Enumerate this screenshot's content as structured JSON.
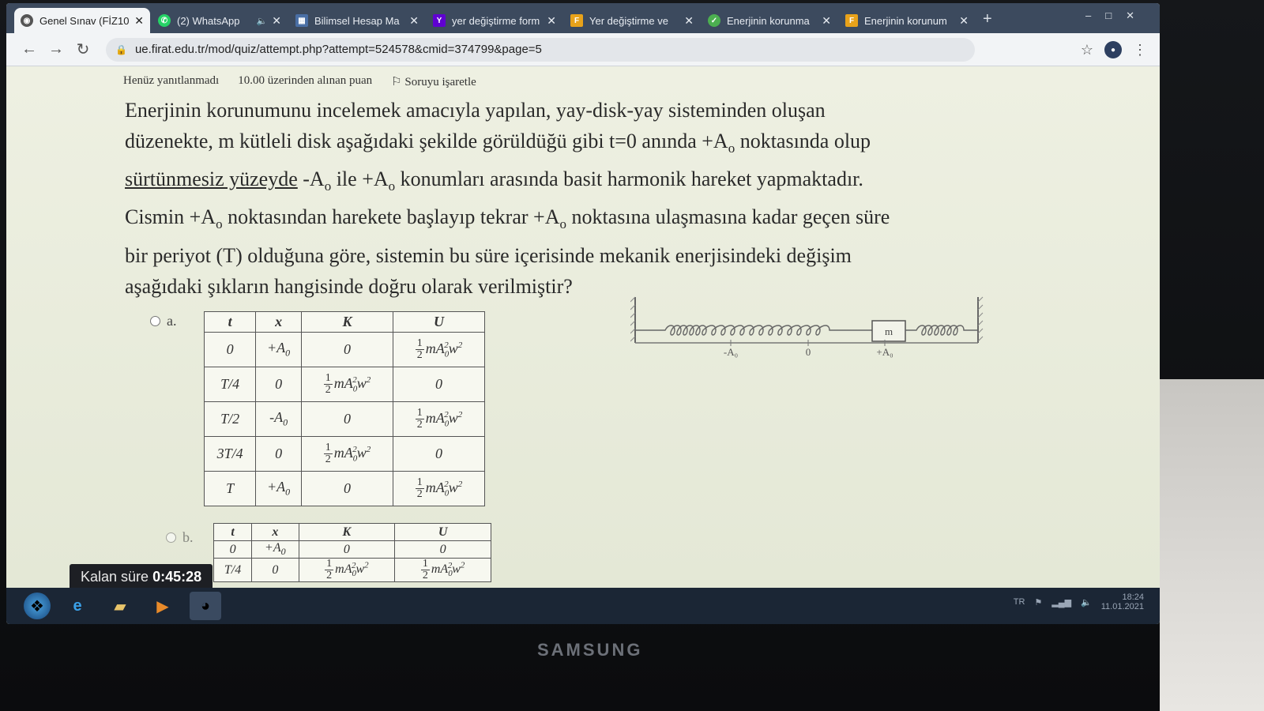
{
  "browser": {
    "tabs": [
      {
        "title": "Genel Sınav (FİZ10",
        "icon": "moodle-icon",
        "active": true,
        "color": "#555555"
      },
      {
        "title": "(2) WhatsApp",
        "icon": "whatsapp-icon",
        "active": false,
        "audio": true,
        "color": "#25d366"
      },
      {
        "title": "Bilimsel Hesap Ma",
        "icon": "calculator-icon",
        "active": false,
        "color": "#4a6fa5"
      },
      {
        "title": "yer değiştirme form",
        "icon": "yahoo-icon",
        "active": false,
        "color": "#5f01d1"
      },
      {
        "title": "Yer değiştirme ve",
        "icon": "document-icon",
        "active": false,
        "color": "#e8a21a"
      },
      {
        "title": "Enerjinin korunma",
        "icon": "shield-icon",
        "active": false,
        "color": "#4caf50"
      },
      {
        "title": "Enerjinin korunum",
        "icon": "document-icon",
        "active": false,
        "color": "#e8a21a"
      }
    ],
    "url": "ue.firat.edu.tr/mod/quiz/attempt.php?attempt=524578&cmid=374799&page=5"
  },
  "question_meta": {
    "status": "Henüz yanıtlanmadı",
    "points": "10.00 üzerinden alınan puan",
    "flag": "Soruyu işaretle"
  },
  "question": {
    "line1": "Enerjinin korunumunu incelemek amacıyla yapılan, yay-disk-yay sisteminden oluşan",
    "line2a": "düzenekte, m kütleli disk aşağıdaki şekilde görüldüğü gibi t=0 anında +A",
    "line2b": " noktasında olup",
    "line3a": "sürtünmesiz yüzeyde",
    "line3b": " -A",
    "line3c": " ile +A",
    "line3d": " konumları arasında basit harmonik hareket yapmaktadır.",
    "line4a": "Cismin +A",
    "line4b": " noktasından harekete başlayıp tekrar +A",
    "line4c": " noktasına ulaşmasına kadar geçen süre",
    "line5": "bir periyot (T) olduğuna göre, sistemin bu süre içerisinde mekanik enerjisindeki değişim",
    "line6": "aşağıdaki şıkların hangisinde doğru olarak verilmiştir?",
    "sub": "o"
  },
  "options": {
    "a_label": "a.",
    "b_label": "b.",
    "headers": [
      "t",
      "x",
      "K",
      "U"
    ],
    "frac_num": "1",
    "frac_den": "2",
    "energy_expr": "mA",
    "energy_sub": "0",
    "energy_sup": "2",
    "energy_w": "w",
    "a_rows": [
      {
        "t": "0",
        "x": "+A",
        "k": "0",
        "u": "E"
      },
      {
        "t": "T/4",
        "x": "0",
        "k": "E",
        "u": "0"
      },
      {
        "t": "T/2",
        "x": "-A",
        "k": "0",
        "u": "E"
      },
      {
        "t": "3T/4",
        "x": "0",
        "k": "E",
        "u": "0"
      },
      {
        "t": "T",
        "x": "+A",
        "k": "0",
        "u": "E"
      }
    ],
    "b_rows": [
      {
        "t": "0",
        "x": "+A",
        "k": "0",
        "u": "0"
      },
      {
        "t": "T/4",
        "x": "0",
        "k": "E",
        "u": "E"
      }
    ]
  },
  "diagram": {
    "mass_label": "m",
    "minus_label": "-A₀",
    "zero_label": "0",
    "plus_label": "+A₀"
  },
  "timer": {
    "label": "Kalan süre",
    "value": "0:45:28"
  },
  "taskbar": {
    "apps": [
      "start-orb-icon",
      "internet-explorer-icon",
      "folder-icon",
      "media-player-icon",
      "chrome-icon"
    ],
    "tray_lang": "TR",
    "clock": "18:24",
    "date": "11.01.2021"
  },
  "monitor_brand": "SAMSUNG"
}
